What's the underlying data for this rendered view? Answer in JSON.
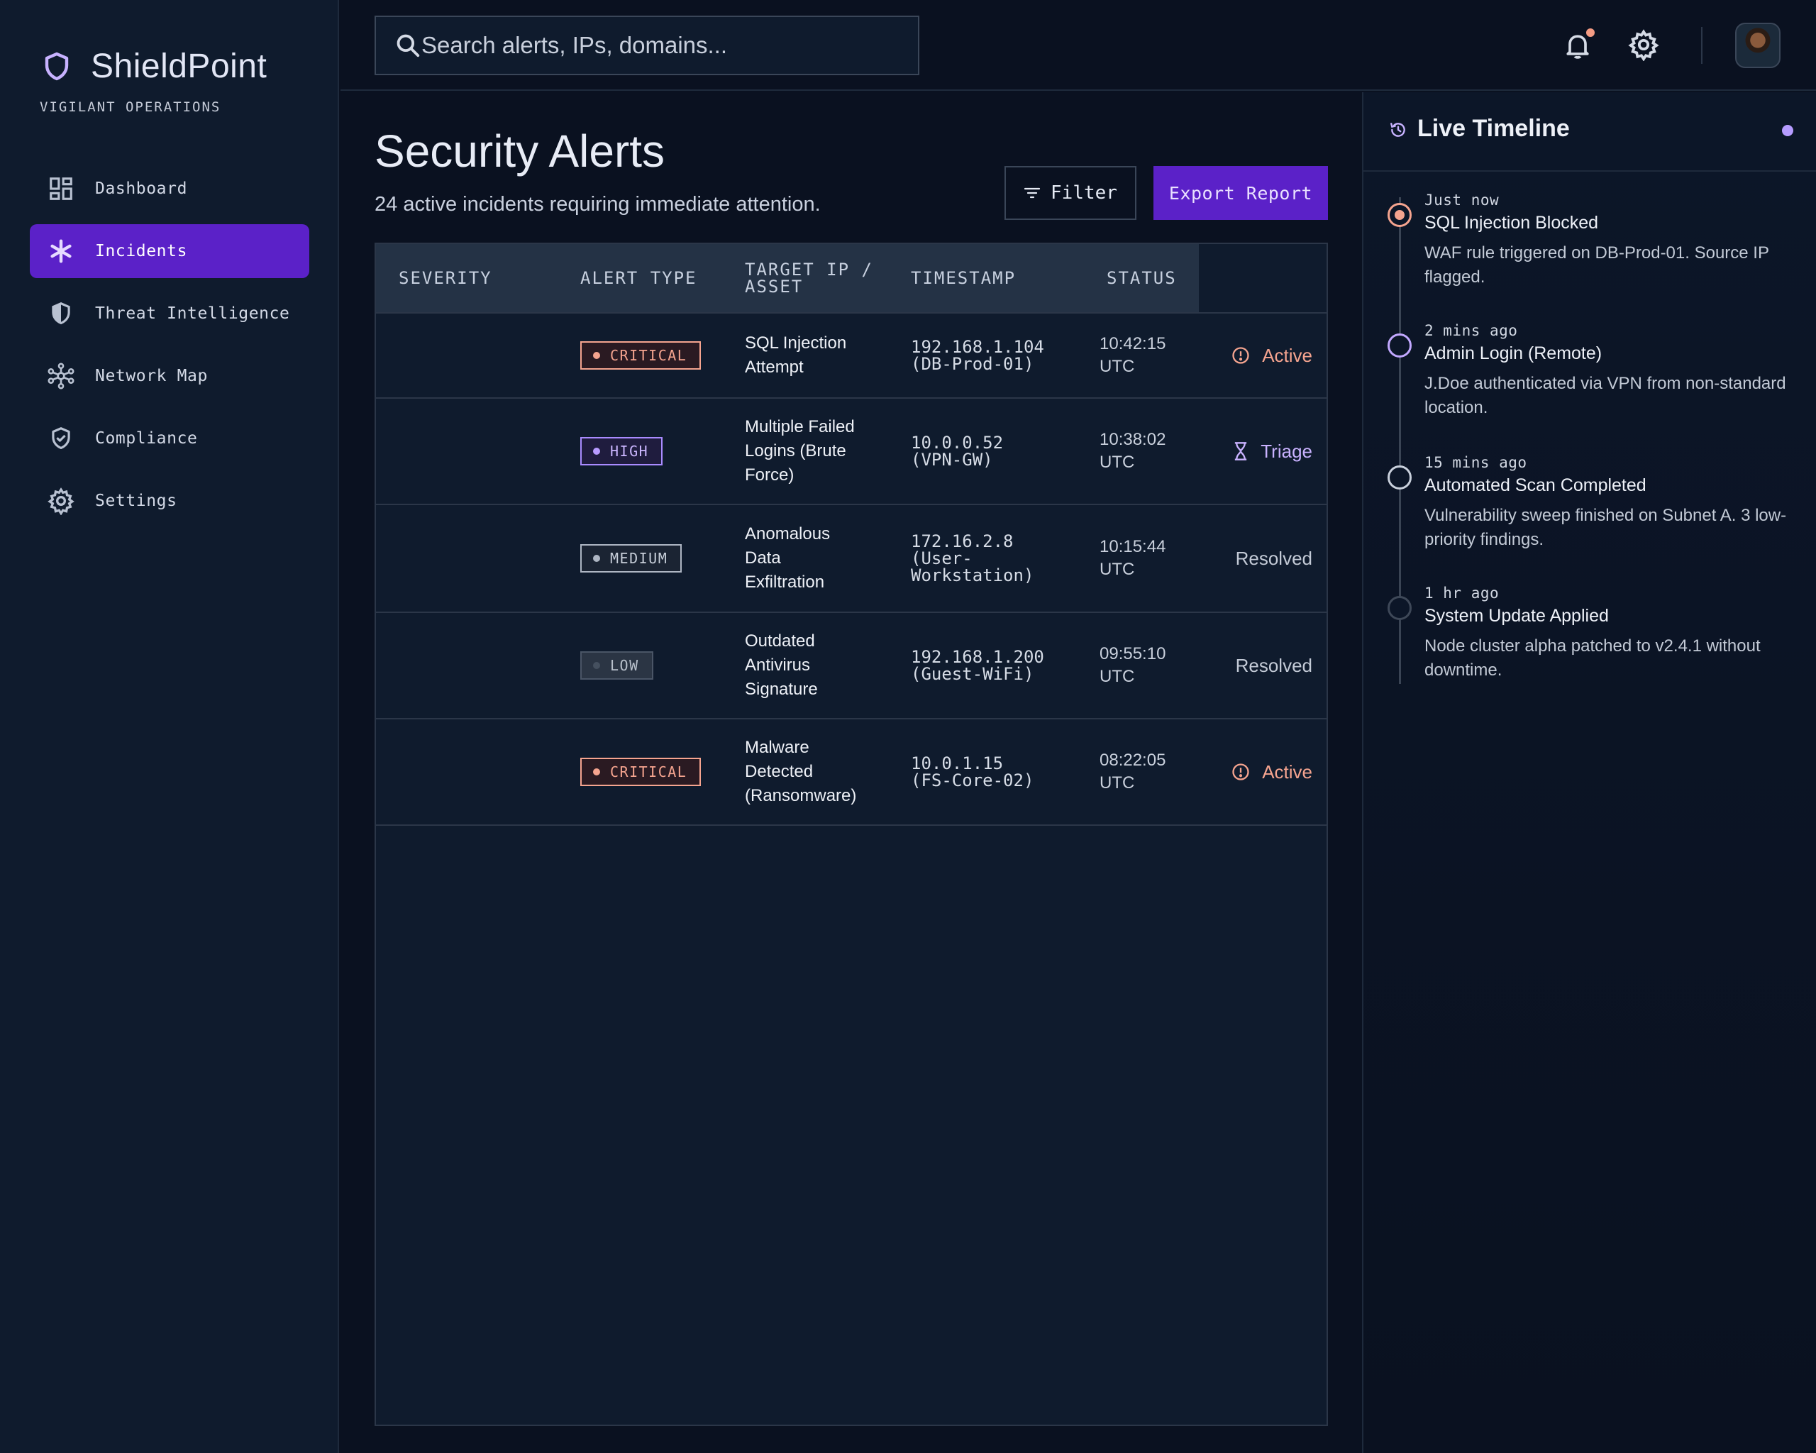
{
  "brand": {
    "name": "ShieldPoint",
    "subtitle": "VIGILANT OPERATIONS"
  },
  "sidebar": {
    "items": [
      {
        "label": "Dashboard",
        "icon": "dashboard-icon",
        "active": false
      },
      {
        "label": "Incidents",
        "icon": "asterisk-icon",
        "active": true
      },
      {
        "label": "Threat Intelligence",
        "icon": "shield-half-icon",
        "active": false
      },
      {
        "label": "Network Map",
        "icon": "network-hub-icon",
        "active": false
      },
      {
        "label": "Compliance",
        "icon": "shield-check-icon",
        "active": false
      },
      {
        "label": "Settings",
        "icon": "gear-icon",
        "active": false
      }
    ]
  },
  "search": {
    "placeholder": "Search alerts, IPs, domains..."
  },
  "page": {
    "title": "Security Alerts",
    "subtitle": "24 active incidents requiring immediate attention.",
    "filter_label": "Filter",
    "export_label": "Export Report"
  },
  "table": {
    "headers": [
      "SEVERITY",
      "ALERT TYPE",
      "TARGET IP / ASSET",
      "TIMESTAMP",
      "STATUS"
    ],
    "rows": [
      {
        "severity": "CRITICAL",
        "type_lines": [
          "SQL Injection",
          "Attempt"
        ],
        "ip": "192.168.1.104",
        "asset": "(DB-Prod-01)",
        "time": "10:42:15",
        "tz": "UTC",
        "status": "Active"
      },
      {
        "severity": "HIGH",
        "type_lines": [
          "Multiple Failed",
          "Logins (Brute",
          "Force)"
        ],
        "ip": "10.0.0.52",
        "asset": "(VPN-GW)",
        "time": "10:38:02",
        "tz": "UTC",
        "status": "Triage"
      },
      {
        "severity": "MEDIUM",
        "type_lines": [
          "Anomalous",
          "Data",
          "Exfiltration"
        ],
        "ip": "172.16.2.8",
        "asset": "(User-",
        "asset2": "Workstation)",
        "time": "10:15:44",
        "tz": "UTC",
        "status": "Resolved"
      },
      {
        "severity": "LOW",
        "type_lines": [
          "Outdated",
          "Antivirus",
          "Signature"
        ],
        "ip": "192.168.1.200",
        "asset": "(Guest-WiFi)",
        "time": "09:55:10",
        "tz": "UTC",
        "status": "Resolved"
      },
      {
        "severity": "CRITICAL",
        "type_lines": [
          "Malware",
          "Detected",
          "(Ransomware)"
        ],
        "ip": "10.0.1.15",
        "asset": "(FS-Core-02)",
        "time": "08:22:05",
        "tz": "UTC",
        "status": "Active"
      }
    ]
  },
  "timeline": {
    "title": "Live Timeline",
    "events": [
      {
        "time": "Just now",
        "title": "SQL Injection Blocked",
        "desc": "WAF rule triggered on DB-Prod-01. Source IP flagged."
      },
      {
        "time": "2 mins ago",
        "title": "Admin Login (Remote)",
        "desc": "J.Doe authenticated via VPN from non-standard location."
      },
      {
        "time": "15 mins ago",
        "title": "Automated Scan Completed",
        "desc": "Vulnerability sweep finished on Subnet A. 3 low-priority findings."
      },
      {
        "time": "1 hr ago",
        "title": "System Update Applied",
        "desc": "Node cluster alpha patched to v2.4.1 without downtime."
      }
    ]
  },
  "colors": {
    "accent": "#5b21c8",
    "critical": "#f5a48f",
    "high": "#b89bff",
    "background": "#0a1120",
    "panel": "#0f1b2d"
  }
}
